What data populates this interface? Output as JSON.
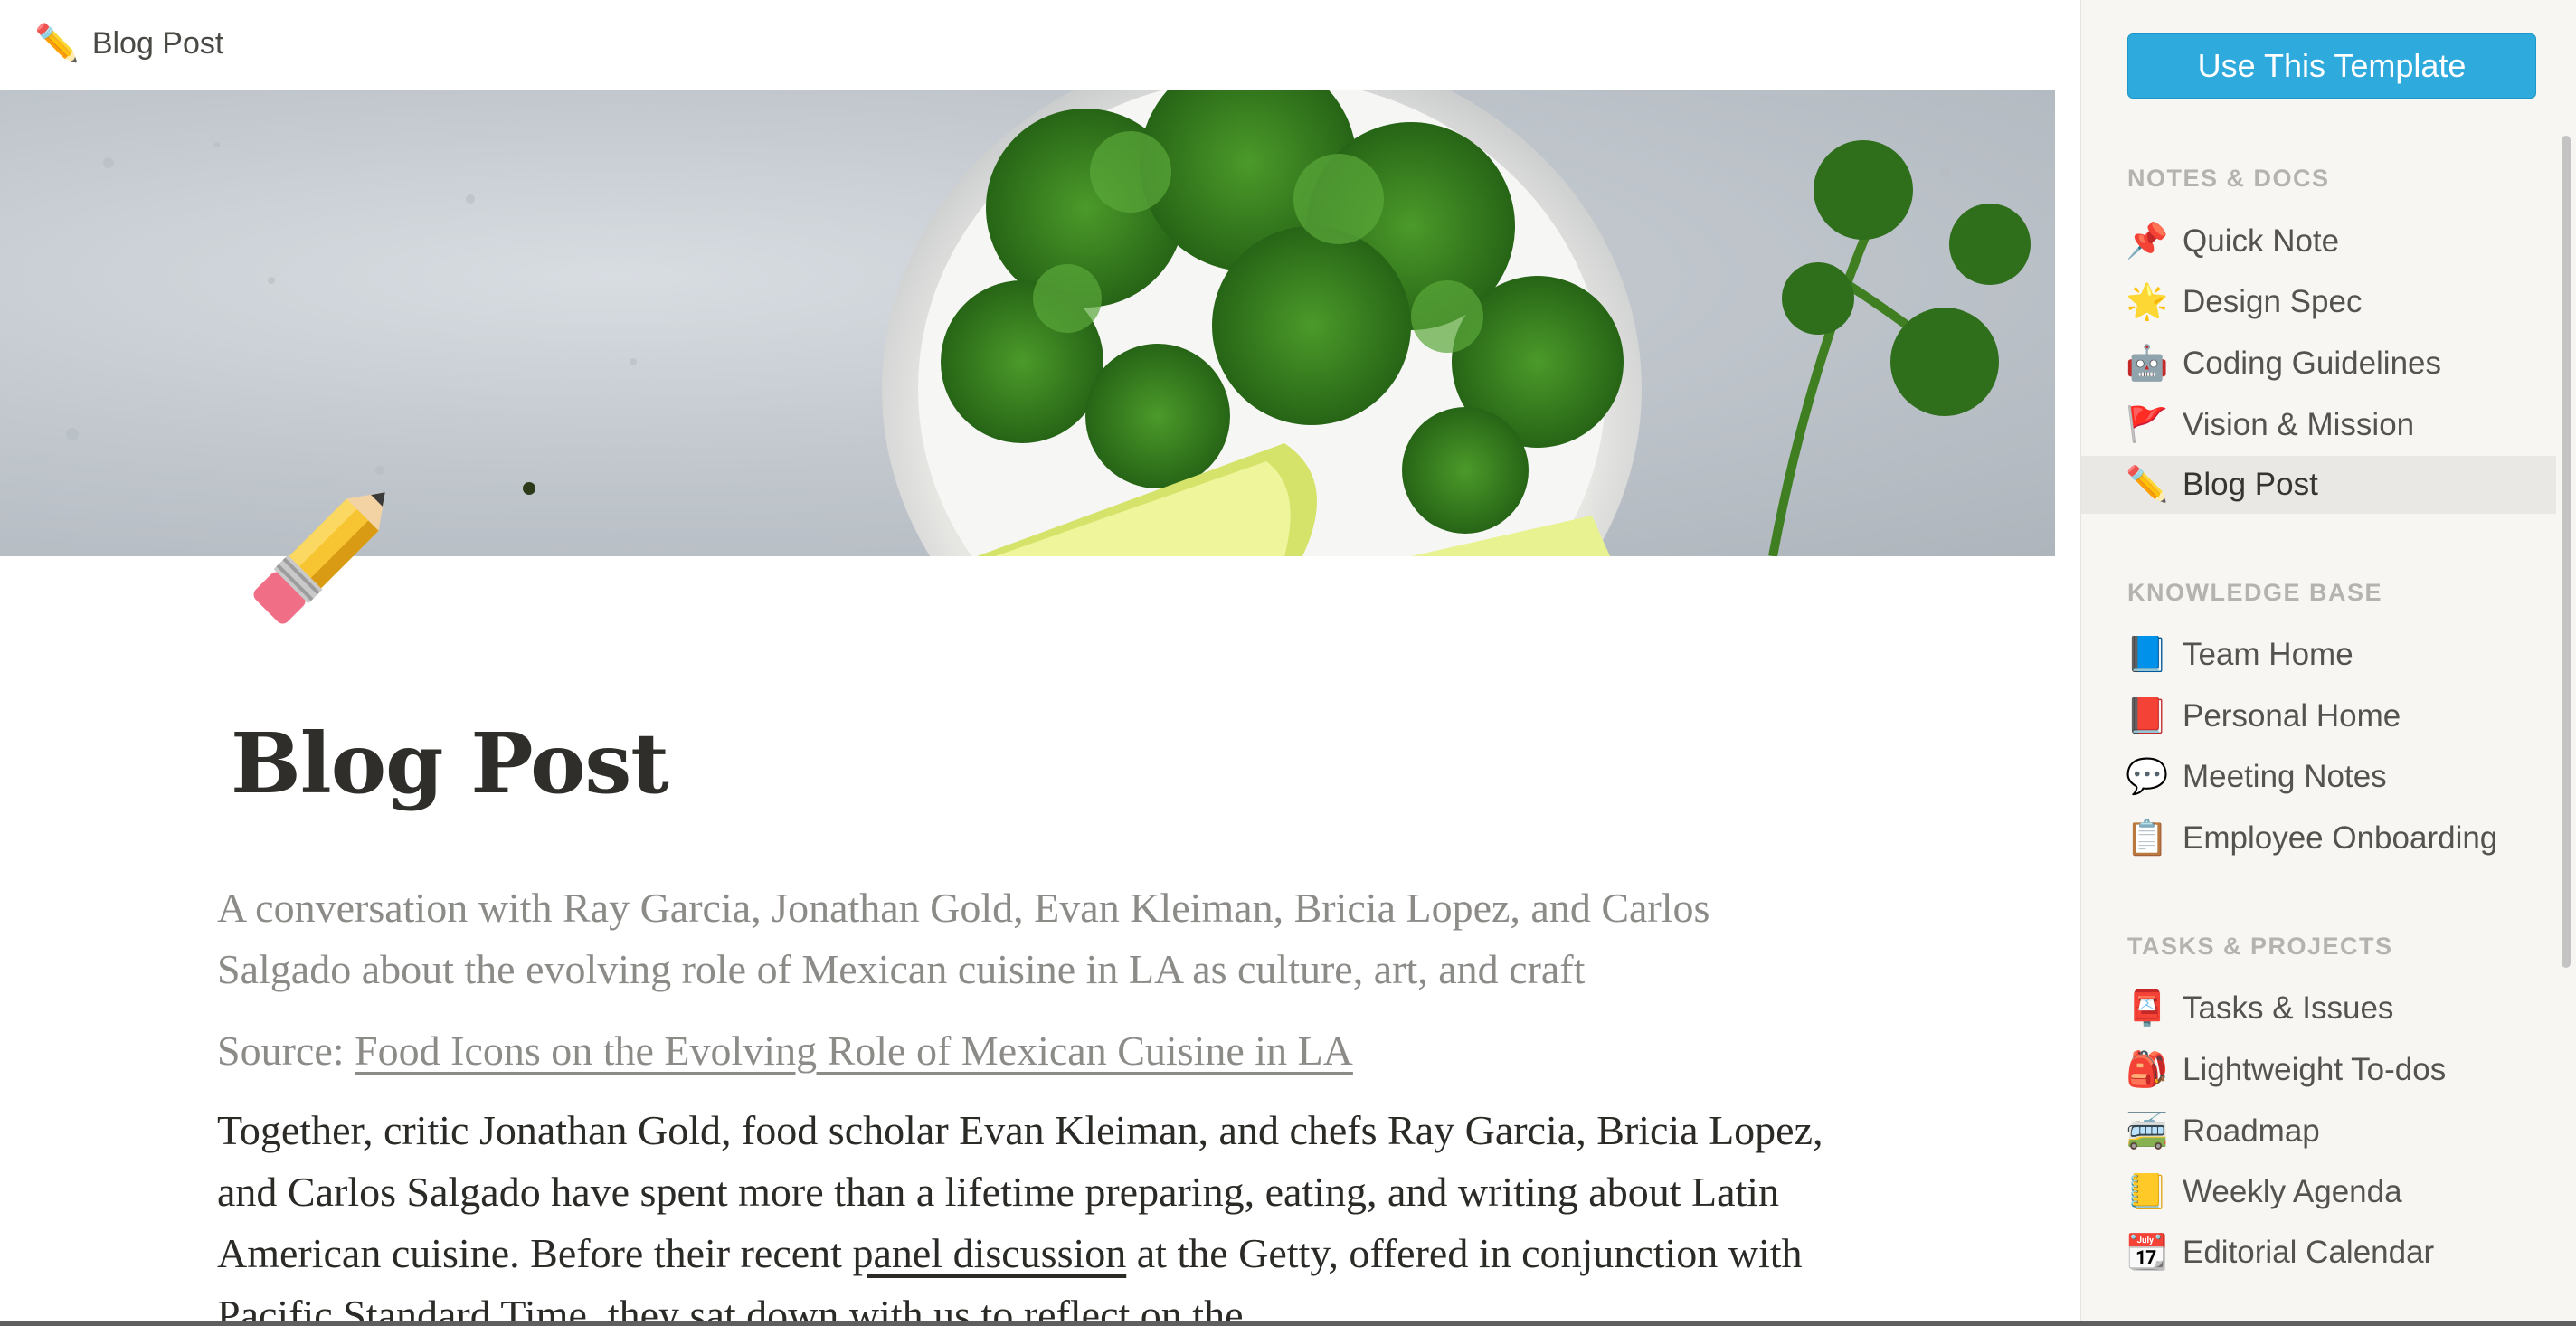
{
  "topbar": {
    "breadcrumb_icon": "✏️",
    "breadcrumb_label": "Blog Post"
  },
  "page": {
    "icon": "pencil-icon",
    "title": "Blog Post",
    "subtitle": "A conversation with Ray Garcia, Jonathan Gold, Evan Kleiman, Bricia Lopez, and Carlos Salgado about the evolving role of Mexican cuisine in LA as culture, art, and craft",
    "source_prefix": "Source: ",
    "source_link": "Food Icons on the Evolving Role of Mexican Cuisine in LA",
    "paragraph_before_link": "Together, critic Jonathan Gold, food scholar Evan Kleiman, and chefs Ray Garcia, Bricia Lopez, and Carlos Salgado have spent more than a lifetime preparing, eating, and writing about Latin American cuisine. Before their recent ",
    "paragraph_link": "panel discussion",
    "paragraph_after_link": " at the Getty, offered in conjunction with Pacific Standard Time, they sat down with us to reflect on the"
  },
  "sidebar": {
    "use_template_label": "Use This Template",
    "sections": [
      {
        "heading": "NOTES & DOCS",
        "items": [
          {
            "icon": "📌",
            "label": "Quick Note"
          },
          {
            "icon": "🌟",
            "label": "Design Spec"
          },
          {
            "icon": "🤖",
            "label": "Coding Guidelines"
          },
          {
            "icon": "🚩",
            "label": "Vision & Mission"
          },
          {
            "icon": "✏️",
            "label": "Blog Post",
            "active": true
          }
        ]
      },
      {
        "heading": "KNOWLEDGE BASE",
        "items": [
          {
            "icon": "📘",
            "label": "Team Home"
          },
          {
            "icon": "📕",
            "label": "Personal Home"
          },
          {
            "icon": "💬",
            "label": "Meeting Notes"
          },
          {
            "icon": "📋",
            "label": "Employee Onboarding"
          }
        ]
      },
      {
        "heading": "TASKS & PROJECTS",
        "items": [
          {
            "icon": "📮",
            "label": "Tasks & Issues"
          },
          {
            "icon": "🎒",
            "label": "Lightweight To-dos"
          },
          {
            "icon": "🚎",
            "label": "Roadmap"
          },
          {
            "icon": "📒",
            "label": "Weekly Agenda"
          },
          {
            "icon": "📆",
            "label": "Editorial Calendar"
          }
        ]
      }
    ]
  },
  "colors": {
    "accent": "#2eaadc",
    "sidebar_bg": "#f7f6f3",
    "muted_text": "#8c8b88"
  }
}
